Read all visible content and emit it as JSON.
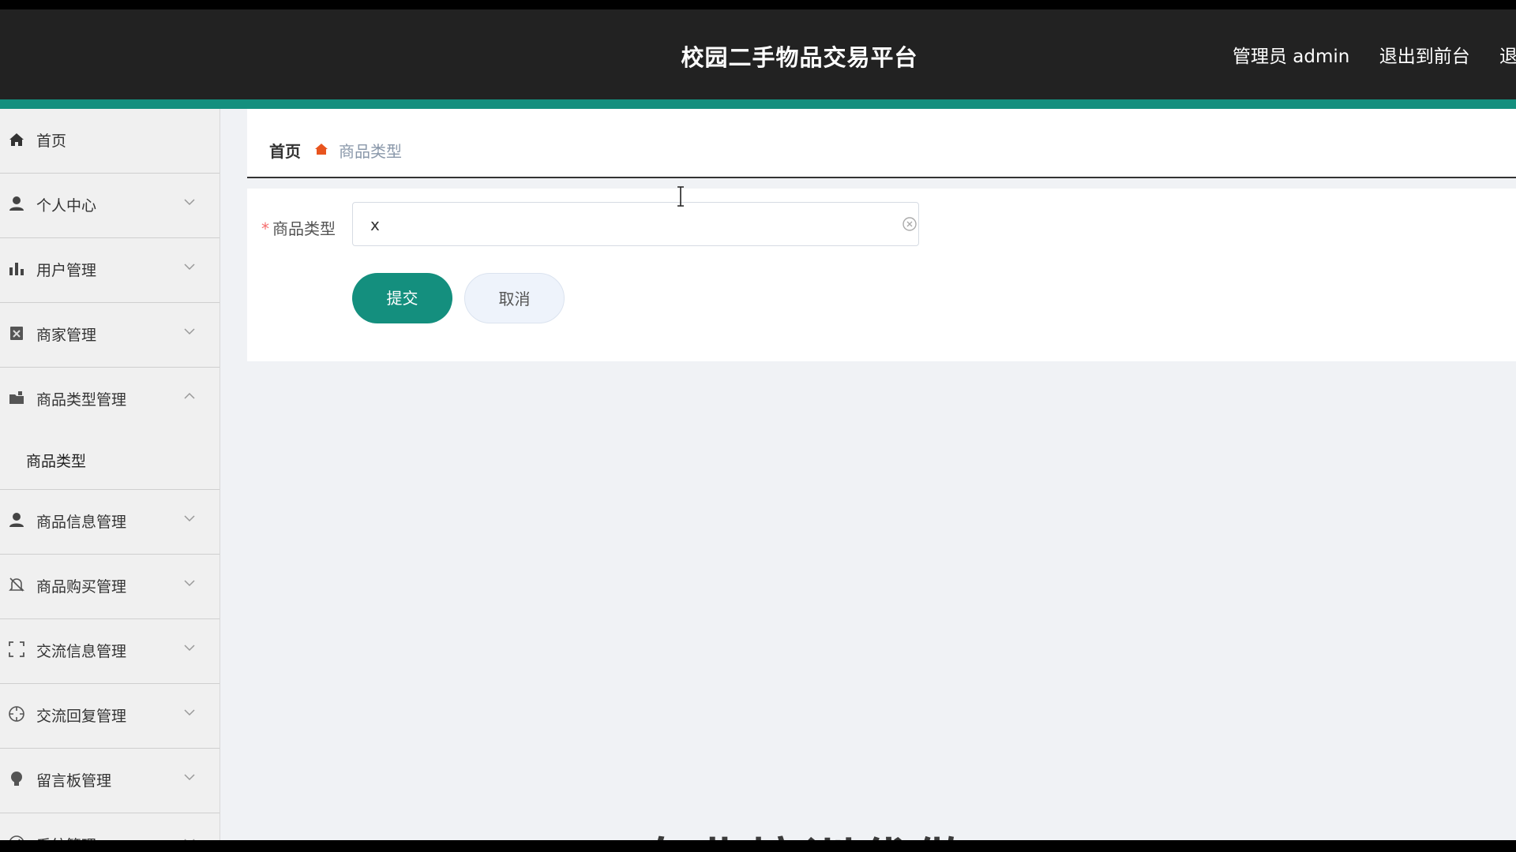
{
  "header": {
    "title": "校园二手物品交易平台",
    "user_label": "管理员 admin",
    "to_frontend_label": "退出到前台",
    "logout_label": "退出"
  },
  "sidebar": {
    "items": [
      {
        "label": "首页",
        "icon": "home-icon"
      },
      {
        "label": "个人中心",
        "icon": "user-icon"
      },
      {
        "label": "用户管理",
        "icon": "bar-chart-icon"
      },
      {
        "label": "商家管理",
        "icon": "clipboard-icon"
      },
      {
        "label": "商品类型管理",
        "icon": "folder-icon",
        "children": [
          {
            "label": "商品类型"
          }
        ]
      },
      {
        "label": "商品信息管理",
        "icon": "user-icon"
      },
      {
        "label": "商品购买管理",
        "icon": "bell-icon"
      },
      {
        "label": "交流信息管理",
        "icon": "fullscreen-icon"
      },
      {
        "label": "交流回复管理",
        "icon": "target-icon"
      },
      {
        "label": "留言板管理",
        "icon": "bulb-icon"
      },
      {
        "label": "系统管理",
        "icon": "gauge-icon"
      }
    ]
  },
  "breadcrumb": {
    "home": "首页",
    "current": "商品类型"
  },
  "form": {
    "field_label": "商品类型",
    "field_value": "x",
    "submit_label": "提交",
    "cancel_label": "取消"
  },
  "colors": {
    "accent": "#148f7e",
    "header_bg": "#222222"
  },
  "watermark": "专业培训代做"
}
